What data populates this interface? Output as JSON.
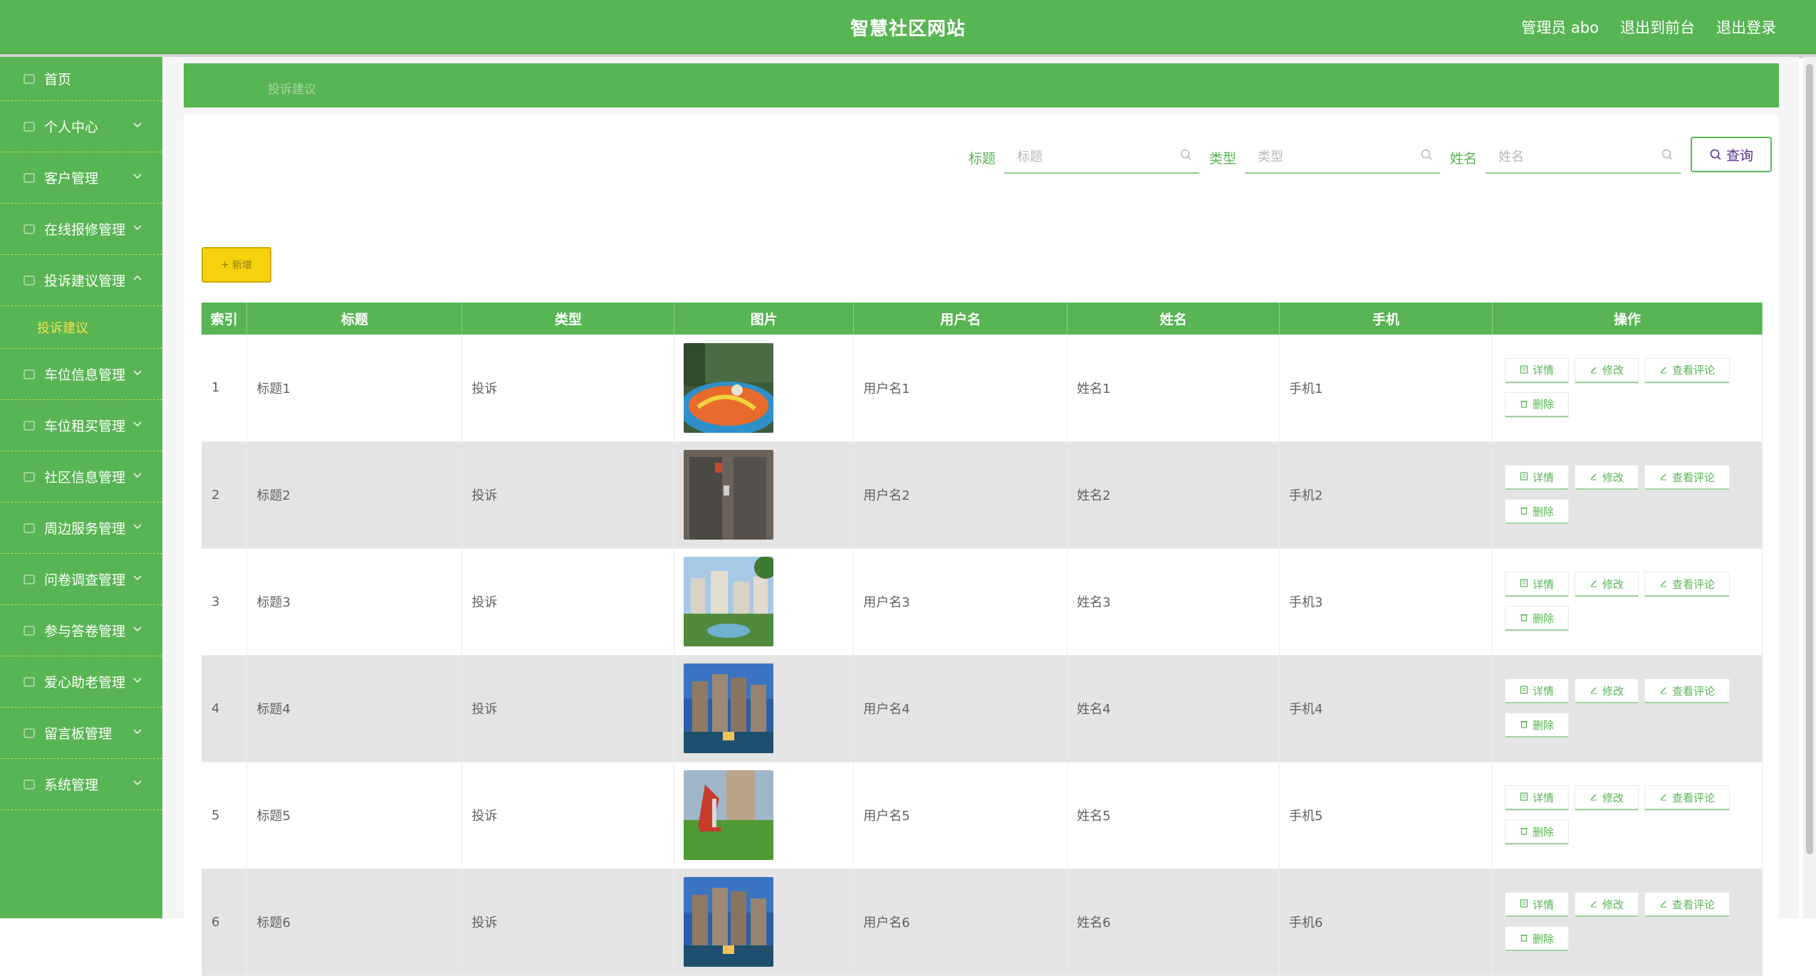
{
  "header": {
    "title": "智慧社区网站",
    "admin_label": "管理员 abo",
    "front_link": "退出到前台",
    "logout_link": "退出登录"
  },
  "sidebar": {
    "items": [
      {
        "label": "首页",
        "icon": "home-icon"
      },
      {
        "label": "个人中心",
        "icon": "user-icon"
      },
      {
        "label": "客户管理",
        "icon": "folder-icon"
      },
      {
        "label": "在线报修管理",
        "icon": "wrench-icon"
      },
      {
        "label": "投诉建议管理",
        "icon": "comment-icon",
        "expanded": true
      },
      {
        "label": "车位信息管理",
        "icon": "car-icon"
      },
      {
        "label": "车位租买管理",
        "icon": "key-icon"
      },
      {
        "label": "社区信息管理",
        "icon": "info-icon"
      },
      {
        "label": "周边服务管理",
        "icon": "shop-icon"
      },
      {
        "label": "问卷调查管理",
        "icon": "document-icon"
      },
      {
        "label": "参与答卷管理",
        "icon": "pen-icon"
      },
      {
        "label": "爱心助老管理",
        "icon": "heart-icon"
      },
      {
        "label": "留言板管理",
        "icon": "message-icon"
      },
      {
        "label": "系统管理",
        "icon": "settings-icon"
      }
    ],
    "sub_item": "投诉建议"
  },
  "breadcrumb": "投诉建议",
  "search": {
    "title_label": "标题",
    "title_placeholder": "标题",
    "type_label": "类型",
    "type_placeholder": "类型",
    "name_label": "姓名",
    "name_placeholder": "姓名",
    "query_button": "查询"
  },
  "add_button": "新增",
  "table": {
    "headers": [
      "索引",
      "标题",
      "类型",
      "图片",
      "用户名",
      "姓名",
      "手机",
      "操作"
    ],
    "rows": [
      {
        "index": "1",
        "title": "标题1",
        "type": "投诉",
        "image": "playground",
        "username": "用户名1",
        "name": "姓名1",
        "phone": "手机1"
      },
      {
        "index": "2",
        "title": "标题2",
        "type": "投诉",
        "image": "elevator",
        "username": "用户名2",
        "name": "姓名2",
        "phone": "手机2"
      },
      {
        "index": "3",
        "title": "标题3",
        "type": "投诉",
        "image": "garden",
        "username": "用户名3",
        "name": "姓名3",
        "phone": "手机3"
      },
      {
        "index": "4",
        "title": "标题4",
        "type": "投诉",
        "image": "towers",
        "username": "用户名4",
        "name": "姓名4",
        "phone": "手机4"
      },
      {
        "index": "5",
        "title": "标题5",
        "type": "投诉",
        "image": "slide",
        "username": "用户名5",
        "name": "姓名5",
        "phone": "手机5"
      },
      {
        "index": "6",
        "title": "标题6",
        "type": "投诉",
        "image": "towers",
        "username": "用户名6",
        "name": "姓名6",
        "phone": "手机6"
      }
    ],
    "actions": {
      "detail": "详情",
      "edit": "修改",
      "comments": "查看评论",
      "delete": "删除"
    }
  },
  "colors": {
    "primary": "#57b553",
    "accent": "#f7d20c",
    "query_text": "#5a2c91"
  }
}
